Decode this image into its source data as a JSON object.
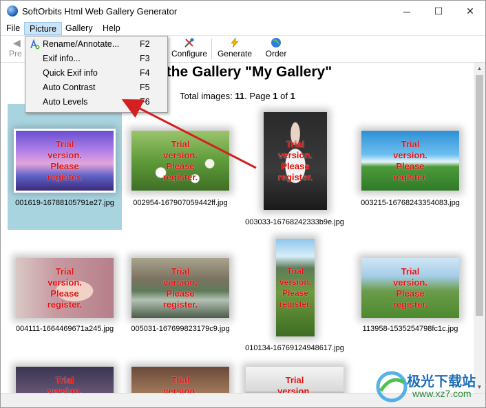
{
  "window": {
    "title": "SoftOrbits Html Web Gallery Generator",
    "controls": {
      "minimize": "─",
      "maximize": "☐",
      "close": "✕"
    }
  },
  "menu": {
    "items": [
      {
        "label": "File"
      },
      {
        "label": "Picture"
      },
      {
        "label": "Gallery"
      },
      {
        "label": "Help"
      }
    ]
  },
  "toolbar": {
    "previous_label": "Pre",
    "configure_label": "Configure",
    "generate_label": "Generate",
    "order_label": "Order"
  },
  "picture_menu": {
    "items": [
      {
        "label": "Rename/Annotate...",
        "key": "F2"
      },
      {
        "label": "Exif info...",
        "key": "F3"
      },
      {
        "label": "Quick Exif info",
        "key": "F4"
      },
      {
        "label": "Auto Contrast",
        "key": "F5"
      },
      {
        "label": "Auto Levels",
        "key": "F6"
      }
    ]
  },
  "gallery": {
    "heading": "for the Gallery \"My Gallery\"",
    "totals_prefix": "Total images: ",
    "total_images": "11",
    "page_label": ". Page ",
    "page": "1",
    "of_label": " of ",
    "page_count": "1",
    "watermark": [
      "Trial",
      "version.",
      "Please",
      "register."
    ],
    "images": [
      {
        "filename": "001619-16788105791e27.jpg"
      },
      {
        "filename": "002954-167907059442ff.jpg"
      },
      {
        "filename": "003033-16768242333b9e.jpg"
      },
      {
        "filename": "003215-16768243354083.jpg"
      },
      {
        "filename": "004111-1664469671a245.jpg"
      },
      {
        "filename": "005031-167699823179c9.jpg"
      },
      {
        "filename": "010134-16769124948617.jpg"
      },
      {
        "filename": "113958-1535254798fc1c.jpg"
      },
      {
        "filename": ""
      },
      {
        "filename": ""
      },
      {
        "filename": ""
      }
    ]
  },
  "logo": {
    "cn_text": "极光下载站",
    "url_text": "www.xz7.com"
  },
  "colors": {
    "selection": "#a8d4e0",
    "menu_highlight": "#91c9f7",
    "watermark": "#e01010",
    "arrow": "#d42020"
  }
}
